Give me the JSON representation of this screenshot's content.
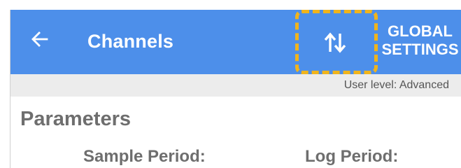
{
  "appbar": {
    "title": "Channels",
    "back_icon": "arrow-left-icon",
    "sort_icon": "swap-vertical-icon",
    "global_settings_line1": "GLOBAL",
    "global_settings_line2": "SETTINGS",
    "background_color": "#4d8fea"
  },
  "status": {
    "user_level": "User level: Advanced"
  },
  "parameters": {
    "heading": "Parameters",
    "sample_period_label": "Sample Period:",
    "log_period_label": "Log Period:"
  },
  "highlight": {
    "color": "#f0b41c",
    "target": "sort-button"
  }
}
